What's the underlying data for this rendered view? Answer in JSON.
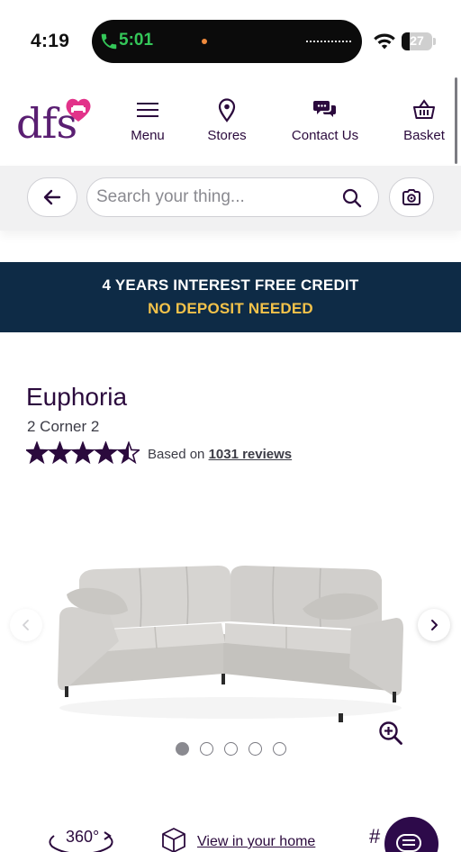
{
  "status_bar": {
    "time": "4:19",
    "call_timer": "5:01",
    "battery_level": "27",
    "battery_fraction": 0.27
  },
  "header": {
    "logo_text": "dfs",
    "nav": [
      {
        "label": "Menu",
        "icon": "hamburger-icon"
      },
      {
        "label": "Stores",
        "icon": "map-pin-icon"
      },
      {
        "label": "Contact Us",
        "icon": "chat-bubbles-icon"
      },
      {
        "label": "Basket",
        "icon": "basket-icon"
      }
    ]
  },
  "search": {
    "placeholder": "Search your thing...",
    "value": ""
  },
  "promo": {
    "line1": "4 YEARS INTEREST FREE CREDIT",
    "line2": "NO DEPOSIT NEEDED"
  },
  "product": {
    "name": "Euphoria",
    "variant": "2 Corner 2",
    "rating": 4.5,
    "rating_max": 5,
    "reviews_prefix": "Based on",
    "reviews_link": "1031 reviews"
  },
  "gallery": {
    "image_count": 5,
    "active_index": 0
  },
  "features": {
    "spin_label": "360°",
    "view_home_label": "View in your home",
    "hash_label": "#"
  },
  "colors": {
    "brand_purple": "#5a1f72",
    "brand_pink": "#e2338a",
    "promo_bg": "#0e2b46",
    "promo_accent": "#f3c24a",
    "call_green": "#34c759"
  }
}
